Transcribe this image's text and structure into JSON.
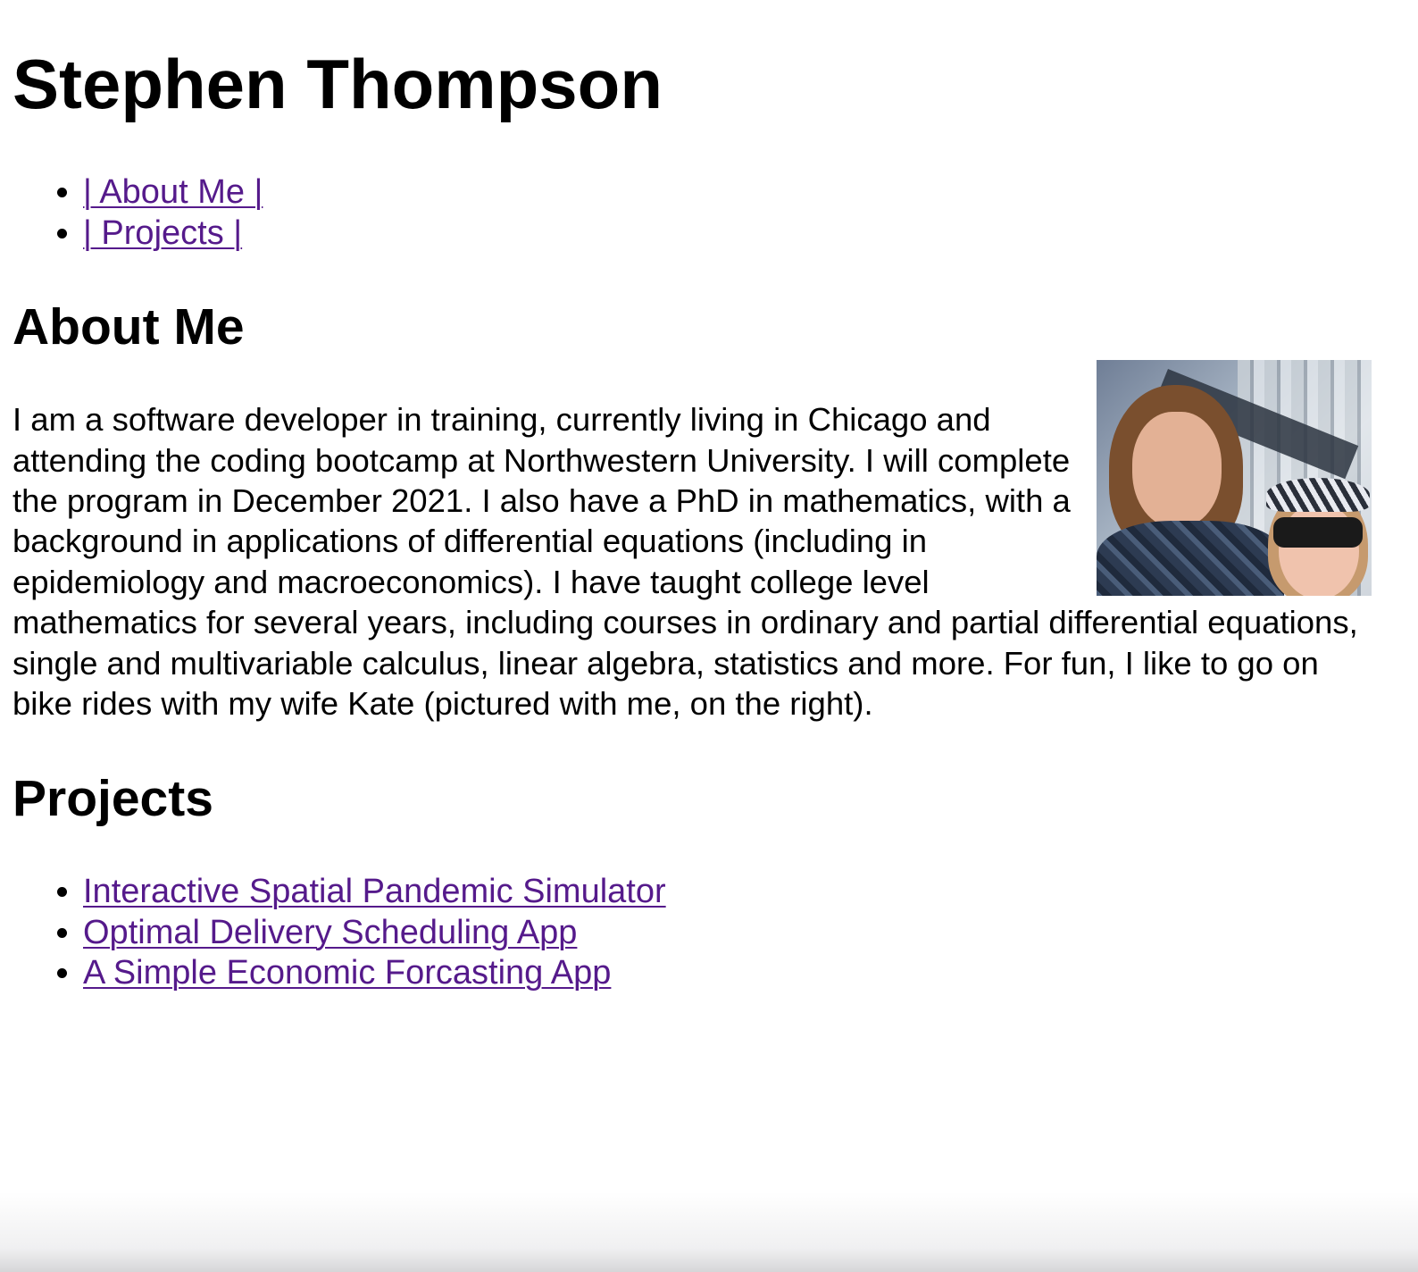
{
  "header": {
    "title": "Stephen Thompson"
  },
  "nav": {
    "items": [
      {
        "label": "| About Me |"
      },
      {
        "label": "| Projects |"
      }
    ]
  },
  "about": {
    "heading": "About Me",
    "body": "I am a software developer in training, currently living in Chicago and attending the coding bootcamp at Northwestern University. I will complete the program in December 2021. I also have a PhD in mathematics, with a background in applications of differential equations (including in epidemiology and macroeconomics). I have taught college level mathematics for several years, including courses in ordinary and partial differential equations, single and multivariable calculus, linear algebra, statistics and more. For fun, I like to go on bike rides with my wife Kate (pictured with me, on the right).",
    "photo_alt": "Stephen and Kate"
  },
  "projects": {
    "heading": "Projects",
    "items": [
      {
        "label": "Interactive Spatial Pandemic Simulator"
      },
      {
        "label": "Optimal Delivery Scheduling App"
      },
      {
        "label": "A Simple Economic Forcasting App"
      }
    ]
  },
  "colors": {
    "link_visited": "#551a8b",
    "text": "#000000",
    "background": "#ffffff"
  }
}
